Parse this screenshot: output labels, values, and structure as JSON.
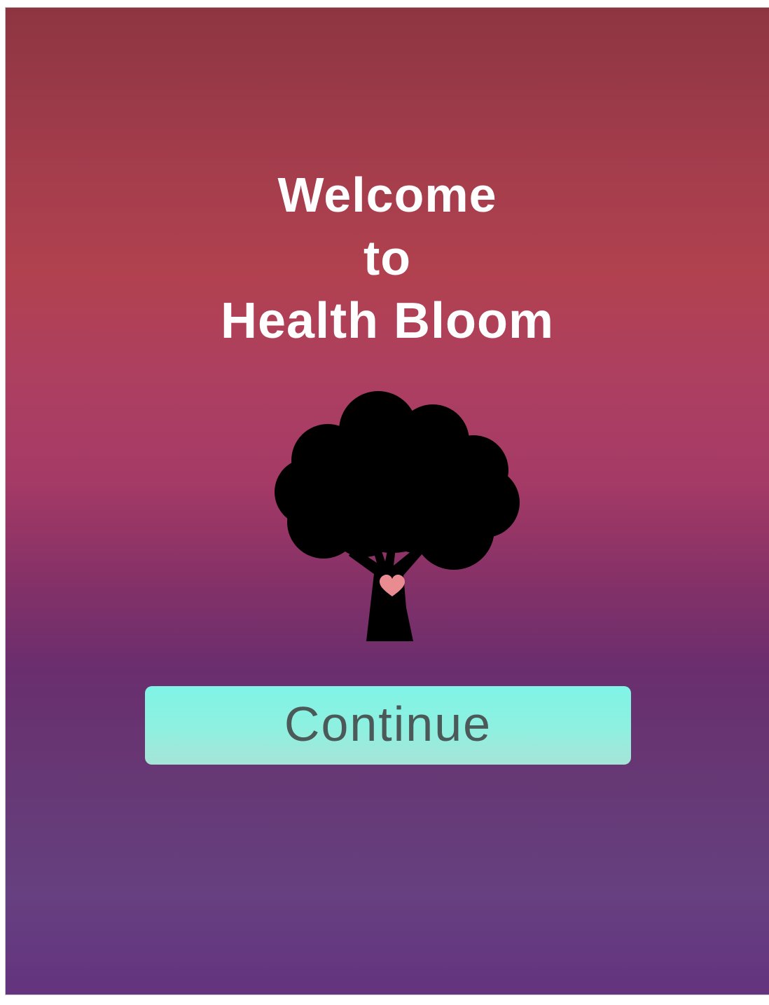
{
  "welcome": {
    "line1": "Welcome",
    "line2": "to",
    "line3": "Health Bloom"
  },
  "logo": {
    "icon": "tree-heart-icon",
    "heart_color": "#e98c92"
  },
  "continue_button": {
    "label": "Continue"
  },
  "colors": {
    "gradient_top": "#8e3542",
    "gradient_mid": "#b1414f",
    "gradient_bottom": "#64337f",
    "button": "#86f0e2",
    "button_text": "#4b5a58"
  }
}
